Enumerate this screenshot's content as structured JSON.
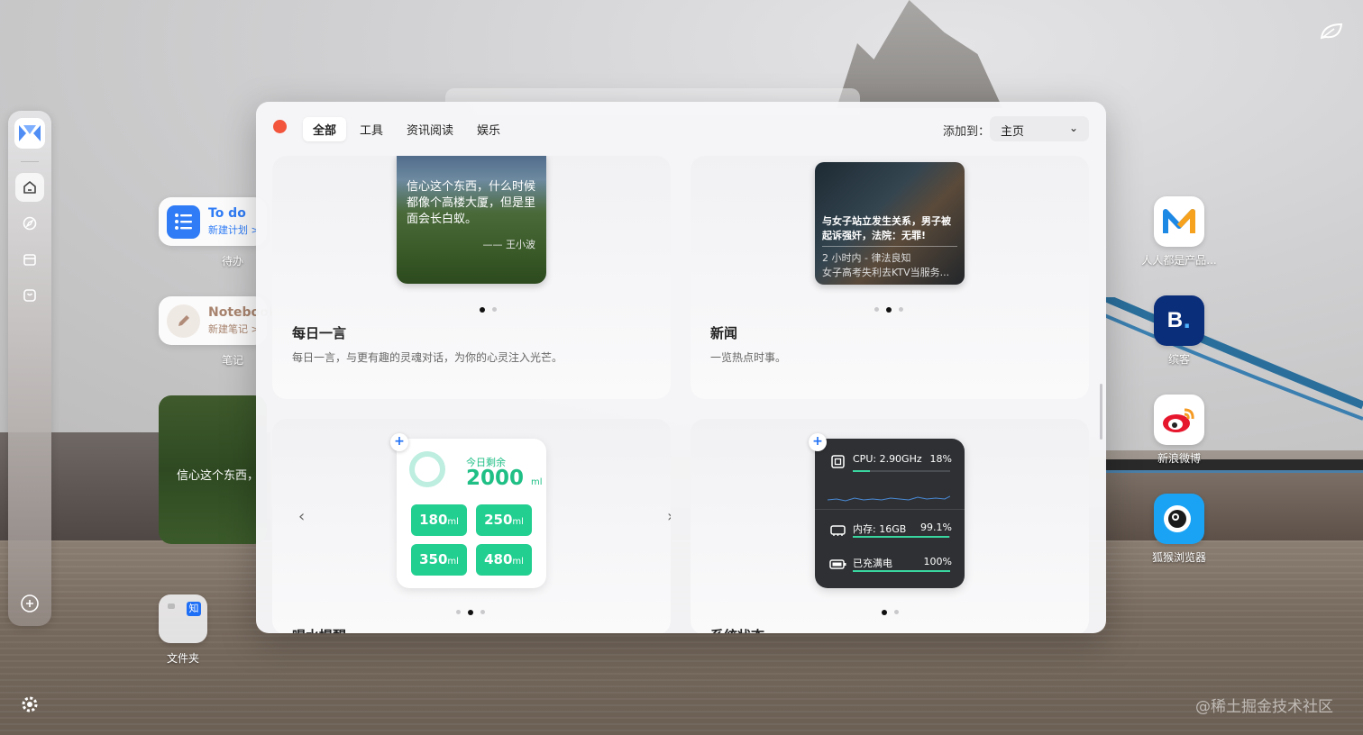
{
  "panel": {
    "tabs": [
      {
        "label": "全部",
        "active": true
      },
      {
        "label": "工具",
        "active": false
      },
      {
        "label": "资讯阅读",
        "active": false
      },
      {
        "label": "娱乐",
        "active": false
      }
    ],
    "add_to_label": "添加到：",
    "add_to_value": "主页"
  },
  "cards": {
    "quote": {
      "title": "每日一言",
      "desc": "每日一言，与更有趣的灵魂对话，为你的心灵注入光芒。",
      "preview_text": "信心这个东西，什么时候都像个高楼大厦，但是里面会长白蚁。",
      "preview_author": "—— 王小波"
    },
    "news": {
      "title": "新闻",
      "desc": "一览热点时事。",
      "headline": "与女子站立发生关系，男子被起诉强奸，法院：无罪!",
      "meta": "2 小时内 - 律法良知",
      "next": "女子高考失利去KTV当服务..."
    },
    "water": {
      "title": "喝水提醒",
      "remain_label": "今日剩余",
      "remain_value": "2000",
      "unit": "ml",
      "buttons": [
        "180",
        "250",
        "350",
        "480"
      ]
    },
    "system": {
      "title": "系统状态",
      "cpu_label": "CPU: 2.90GHz",
      "cpu_value": "18%",
      "mem_label": "内存: 16GB",
      "mem_value": "99.1%",
      "battery_label": "已充满电",
      "battery_value": "100%"
    }
  },
  "desktop": {
    "todo": {
      "title": "To do",
      "sub": "新建计划 >",
      "caption": "待办"
    },
    "note": {
      "title": "Notebook",
      "sub": "新建笔记 >",
      "caption": "笔记"
    },
    "quote_text": "信心这个东西，",
    "folder": {
      "caption": "文件夹",
      "zhi": "知"
    }
  },
  "apps": [
    {
      "label": "人人都是产品..."
    },
    {
      "label": "缤客"
    },
    {
      "label": "新浪微博"
    },
    {
      "label": "狐猴浏览器"
    }
  ],
  "watermark": "@稀土掘金技术社区",
  "colors": {
    "accent": "#1e6ff5",
    "water_green": "#22cf91",
    "close_red": "#f2543c"
  }
}
